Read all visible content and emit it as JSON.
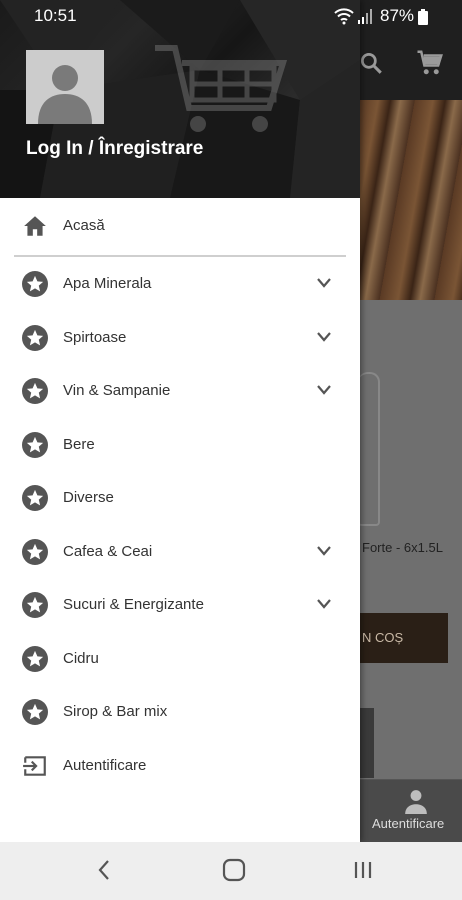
{
  "status_bar": {
    "time": "10:51",
    "battery": "87%"
  },
  "drawer": {
    "login_label": "Log In / Înregistrare",
    "items": [
      {
        "label": "Acasă",
        "icon": "home-icon",
        "expandable": false
      },
      {
        "label": "Apa Minerala",
        "icon": "star-circle-icon",
        "expandable": true
      },
      {
        "label": "Spirtoase",
        "icon": "star-circle-icon",
        "expandable": true
      },
      {
        "label": "Vin & Sampanie",
        "icon": "star-circle-icon",
        "expandable": true
      },
      {
        "label": "Bere",
        "icon": "star-circle-icon",
        "expandable": false
      },
      {
        "label": "Diverse",
        "icon": "star-circle-icon",
        "expandable": false
      },
      {
        "label": "Cafea & Ceai",
        "icon": "star-circle-icon",
        "expandable": true
      },
      {
        "label": "Sucuri & Energizante",
        "icon": "star-circle-icon",
        "expandable": true
      },
      {
        "label": "Cidru",
        "icon": "star-circle-icon",
        "expandable": false
      },
      {
        "label": "Sirop & Bar mix",
        "icon": "star-circle-icon",
        "expandable": false
      },
      {
        "label": "Autentificare",
        "icon": "login-icon",
        "expandable": false
      }
    ]
  },
  "background": {
    "product_title": "Forte - 6x1.5L",
    "add_button": "N COȘ",
    "bottom_nav_label": "Autentificare"
  },
  "colors": {
    "icon": "#555555",
    "header_bg": "#1c1c1c",
    "accent_dark": "#2a1f16"
  }
}
